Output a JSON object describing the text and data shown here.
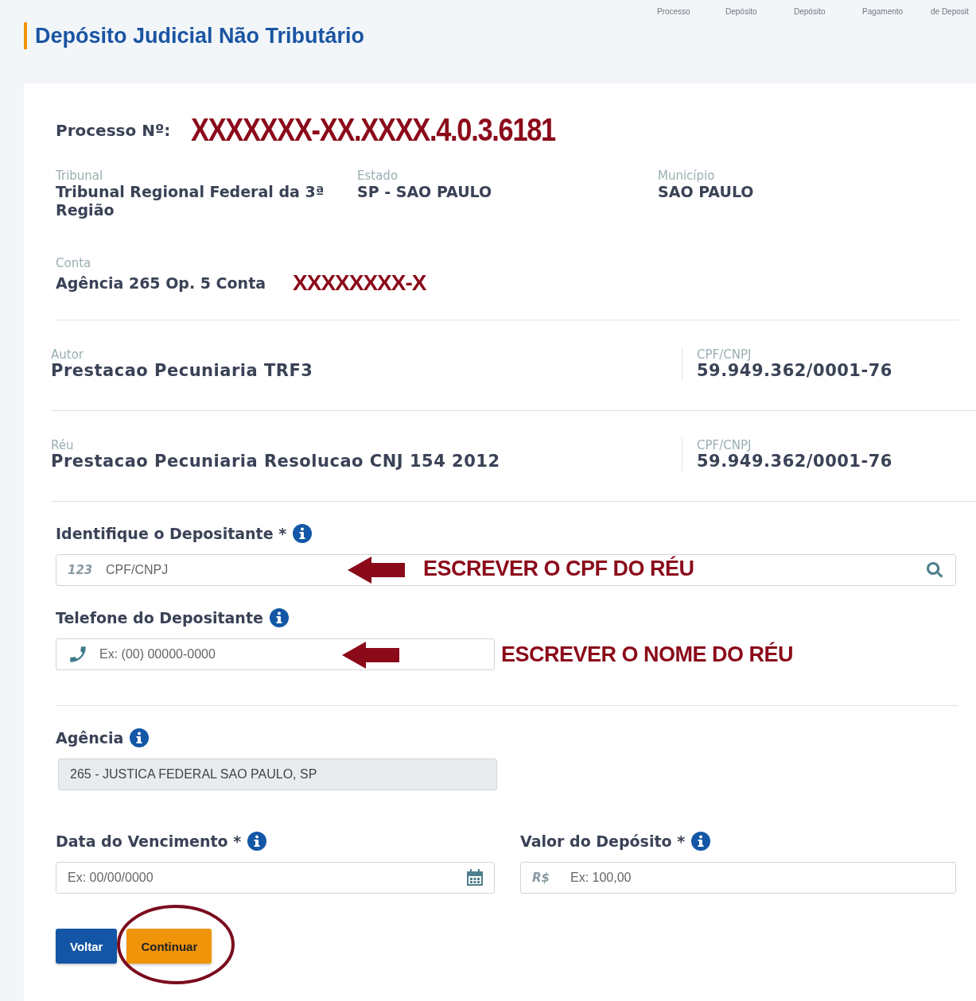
{
  "steps": [
    {
      "label": "Processo"
    },
    {
      "label": "Depósito"
    },
    {
      "label": "Depósito"
    },
    {
      "label": "Pagamento"
    },
    {
      "label": "de Deposit"
    }
  ],
  "page_title": "Depósito Judicial Não Tributário",
  "process": {
    "label": "Processo Nº:",
    "number": "XXXXXXX-XX.XXXX.4.0.3.6181"
  },
  "details": [
    {
      "label": "Tribunal",
      "value": "Tribunal Regional Federal da 3ª Região"
    },
    {
      "label": "Estado",
      "value": "SP - SAO PAULO"
    },
    {
      "label": "Município",
      "value": "SAO PAULO"
    }
  ],
  "account": {
    "label": "Conta",
    "value": "Agência 265 Op. 5 Conta",
    "number": "XXXXXXXX-X"
  },
  "parties": [
    {
      "label": "Autor",
      "name": "Prestacao Pecuniaria TRF3",
      "doc_label": "CPF/CNPJ",
      "doc": "59.949.362/0001-76"
    },
    {
      "label": "Réu",
      "name": "Prestacao Pecuniaria Resolucao CNJ 154 2012",
      "doc_label": "CPF/CNPJ",
      "doc": "59.949.362/0001-76"
    }
  ],
  "depositante": {
    "label": "Identifique o Depositante *",
    "prefix": "123",
    "placeholder": "CPF/CNPJ",
    "annotation": "ESCREVER O CPF DO RÉU"
  },
  "telefone": {
    "label": "Telefone do Depositante",
    "placeholder": "Ex: (00) 00000-0000",
    "annotation": "ESCREVER O NOME DO RÉU"
  },
  "agencia": {
    "label": "Agência",
    "value": "265 - JUSTICA FEDERAL SAO PAULO, SP",
    "disabled": true
  },
  "vencimento": {
    "label": "Data do Vencimento *",
    "placeholder": "Ex: 00/00/0000"
  },
  "valor": {
    "label": "Valor do Depósito *",
    "prefix": "R$",
    "placeholder": "Ex: 100,00"
  },
  "buttons": [
    {
      "label": "Voltar",
      "kind": "primary",
      "highlighted": false
    },
    {
      "label": "Continuar",
      "kind": "warning",
      "highlighted": true
    }
  ]
}
